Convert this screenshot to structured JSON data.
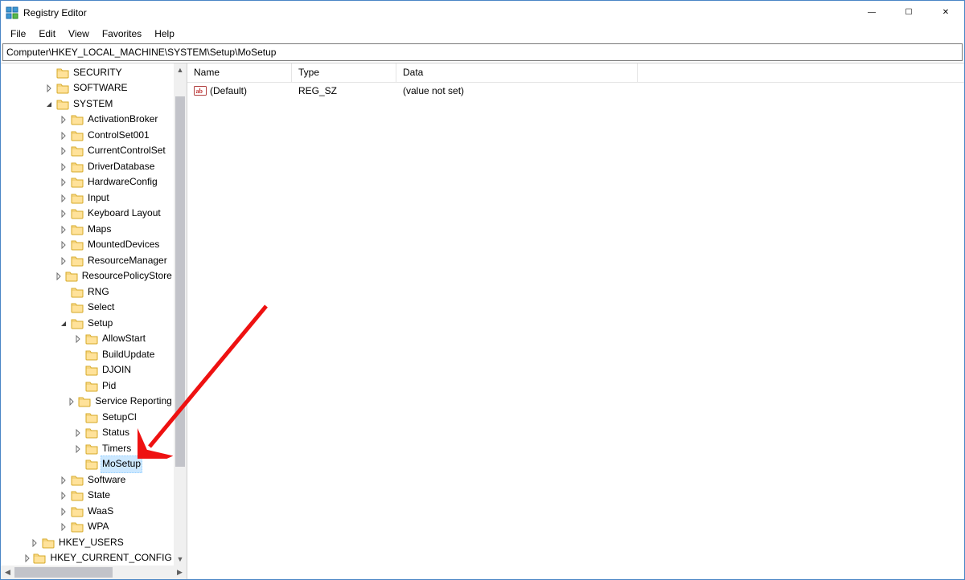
{
  "app": {
    "title": "Registry Editor"
  },
  "window_controls": {
    "minimize": "—",
    "maximize": "☐",
    "close": "✕"
  },
  "menubar": {
    "file": "File",
    "edit": "Edit",
    "view": "View",
    "favorites": "Favorites",
    "help": "Help"
  },
  "addressbar": {
    "path": "Computer\\HKEY_LOCAL_MACHINE\\SYSTEM\\Setup\\MoSetup"
  },
  "tree": {
    "items": [
      {
        "indent": 2,
        "exp": "none",
        "label": "SECURITY"
      },
      {
        "indent": 2,
        "exp": "closed",
        "label": "SOFTWARE"
      },
      {
        "indent": 2,
        "exp": "open",
        "label": "SYSTEM"
      },
      {
        "indent": 3,
        "exp": "closed",
        "label": "ActivationBroker"
      },
      {
        "indent": 3,
        "exp": "closed",
        "label": "ControlSet001"
      },
      {
        "indent": 3,
        "exp": "closed",
        "label": "CurrentControlSet"
      },
      {
        "indent": 3,
        "exp": "closed",
        "label": "DriverDatabase"
      },
      {
        "indent": 3,
        "exp": "closed",
        "label": "HardwareConfig"
      },
      {
        "indent": 3,
        "exp": "closed",
        "label": "Input"
      },
      {
        "indent": 3,
        "exp": "closed",
        "label": "Keyboard Layout"
      },
      {
        "indent": 3,
        "exp": "closed",
        "label": "Maps"
      },
      {
        "indent": 3,
        "exp": "closed",
        "label": "MountedDevices"
      },
      {
        "indent": 3,
        "exp": "closed",
        "label": "ResourceManager"
      },
      {
        "indent": 3,
        "exp": "closed",
        "label": "ResourcePolicyStore"
      },
      {
        "indent": 3,
        "exp": "none",
        "label": "RNG"
      },
      {
        "indent": 3,
        "exp": "none",
        "label": "Select"
      },
      {
        "indent": 3,
        "exp": "open",
        "label": "Setup"
      },
      {
        "indent": 4,
        "exp": "closed",
        "label": "AllowStart"
      },
      {
        "indent": 4,
        "exp": "none",
        "label": "BuildUpdate"
      },
      {
        "indent": 4,
        "exp": "none",
        "label": "DJOIN"
      },
      {
        "indent": 4,
        "exp": "none",
        "label": "Pid"
      },
      {
        "indent": 4,
        "exp": "closed",
        "label": "Service Reporting"
      },
      {
        "indent": 4,
        "exp": "none",
        "label": "SetupCl"
      },
      {
        "indent": 4,
        "exp": "closed",
        "label": "Status"
      },
      {
        "indent": 4,
        "exp": "closed",
        "label": "Timers"
      },
      {
        "indent": 4,
        "exp": "none",
        "label": "MoSetup",
        "selected": true
      },
      {
        "indent": 3,
        "exp": "closed",
        "label": "Software"
      },
      {
        "indent": 3,
        "exp": "closed",
        "label": "State"
      },
      {
        "indent": 3,
        "exp": "closed",
        "label": "WaaS"
      },
      {
        "indent": 3,
        "exp": "closed",
        "label": "WPA"
      },
      {
        "indent": 1,
        "exp": "closed",
        "label": "HKEY_USERS"
      },
      {
        "indent": 1,
        "exp": "closed",
        "label": "HKEY_CURRENT_CONFIG"
      }
    ]
  },
  "columns": {
    "name": "Name",
    "type": "Type",
    "data": "Data"
  },
  "values": [
    {
      "name": "(Default)",
      "type": "REG_SZ",
      "data": "(value not set)"
    }
  ]
}
